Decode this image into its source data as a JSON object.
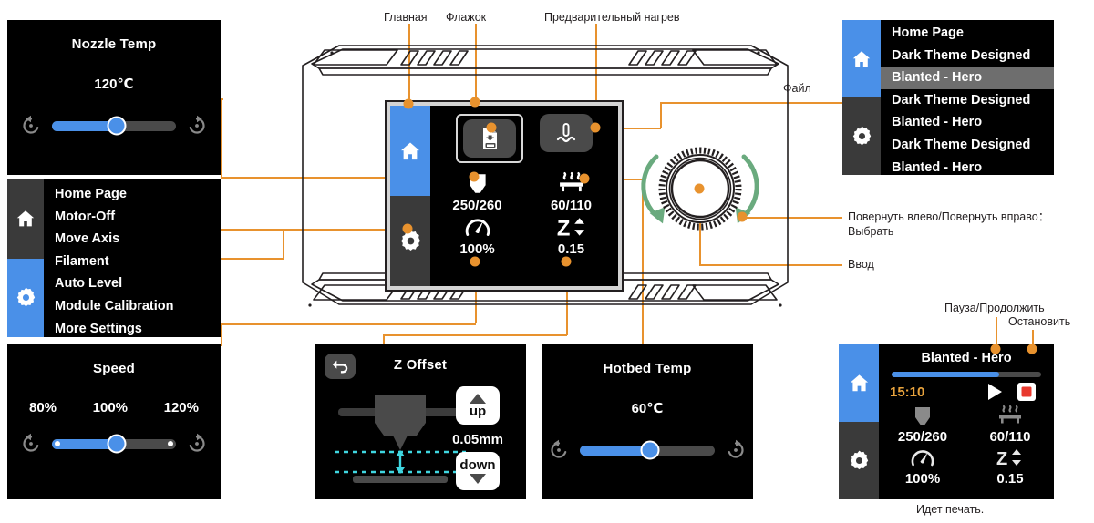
{
  "colors": {
    "accent_orange": "#e8922e",
    "blue": "#4a90e8",
    "screen_black": "#000000",
    "sidebar_gray": "#3a3a3a",
    "selected_gray": "#6e6e6e",
    "arrow_green": "#6aaa7e",
    "time_amber": "#e8a33d",
    "stop_red": "#e8392e",
    "cyan": "#3fd6e0"
  },
  "annotations": {
    "home": "Главная",
    "checkbox": "Флажок",
    "preheat": "Предварительный нагрев",
    "file": "Файл",
    "rotate": "Повернуть влево/Повернуть вправо：",
    "rotate_line2": "Выбрать",
    "enter": "Ввод",
    "pause_resume": "Пауза/Продолжить",
    "stop": "Остановить",
    "printing": "Идет печать."
  },
  "nozzle_panel": {
    "title": "Nozzle Temp",
    "value": "120℃",
    "fill_percent": 52,
    "left_icon": "rotate-left-icon",
    "right_icon": "rotate-right-icon"
  },
  "settings_menu": {
    "sidebar": [
      "home-icon",
      "gear-icon"
    ],
    "items": [
      {
        "label": "Home Page",
        "selected": false
      },
      {
        "label": "Motor-Off",
        "selected": false
      },
      {
        "label": "Move Axis",
        "selected": false
      },
      {
        "label": "Filament",
        "selected": false
      },
      {
        "label": "Auto Level",
        "selected": false
      },
      {
        "label": "Module Calibration",
        "selected": false
      },
      {
        "label": "More Settings",
        "selected": false
      }
    ]
  },
  "speed_panel": {
    "title": "Speed",
    "tick_low": "80%",
    "tick_mid": "100%",
    "tick_high": "120%",
    "fill_percent": 52,
    "left_icon": "rotate-left-icon",
    "right_icon": "rotate-right-icon"
  },
  "zoffset_panel": {
    "title": "Z Offset",
    "back_icon": "back-arrow-icon",
    "up_label": "up",
    "down_label": "down",
    "step_value": "0.05mm"
  },
  "hotbed_panel": {
    "title": "Hotbed Temp",
    "value": "60℃",
    "fill_percent": 52,
    "left_icon": "rotate-left-icon",
    "right_icon": "rotate-right-icon"
  },
  "printer_screen": {
    "tile_file": "file-print-icon",
    "tile_preheat": "preheat-thermometer-icon",
    "cells": [
      {
        "icon": "nozzle-icon",
        "value": "250/260"
      },
      {
        "icon": "hotbed-icon",
        "value": "60/110"
      },
      {
        "icon": "speed-gauge-icon",
        "value": "100%"
      },
      {
        "icon": "z-offset-icon",
        "value": "0.15"
      }
    ]
  },
  "file_list_panel": {
    "items": [
      {
        "label": "Home Page",
        "selected": false
      },
      {
        "label": "Dark Theme Designed",
        "selected": false
      },
      {
        "label": "Blanted - Hero",
        "selected": true
      },
      {
        "label": "Dark Theme Designed",
        "selected": false
      },
      {
        "label": "Blanted - Hero",
        "selected": false
      },
      {
        "label": "Dark Theme Designed",
        "selected": false
      },
      {
        "label": "Blanted - Hero",
        "selected": false
      }
    ]
  },
  "printing_panel": {
    "job_title": "Blanted - Hero",
    "elapsed": "15:10",
    "progress_percent": 72,
    "play_icon": "play-icon",
    "stop_icon": "stop-icon",
    "cells": [
      {
        "icon": "nozzle-icon",
        "value": "250/260"
      },
      {
        "icon": "hotbed-icon",
        "value": "60/110"
      },
      {
        "icon": "speed-gauge-icon",
        "value": "100%"
      },
      {
        "icon": "z-offset-icon",
        "value": "0.15"
      }
    ]
  },
  "knob": {
    "left_arrow": "rotate-ccw-arrow-icon",
    "right_arrow": "rotate-cw-arrow-icon",
    "center": "knob-dial"
  }
}
